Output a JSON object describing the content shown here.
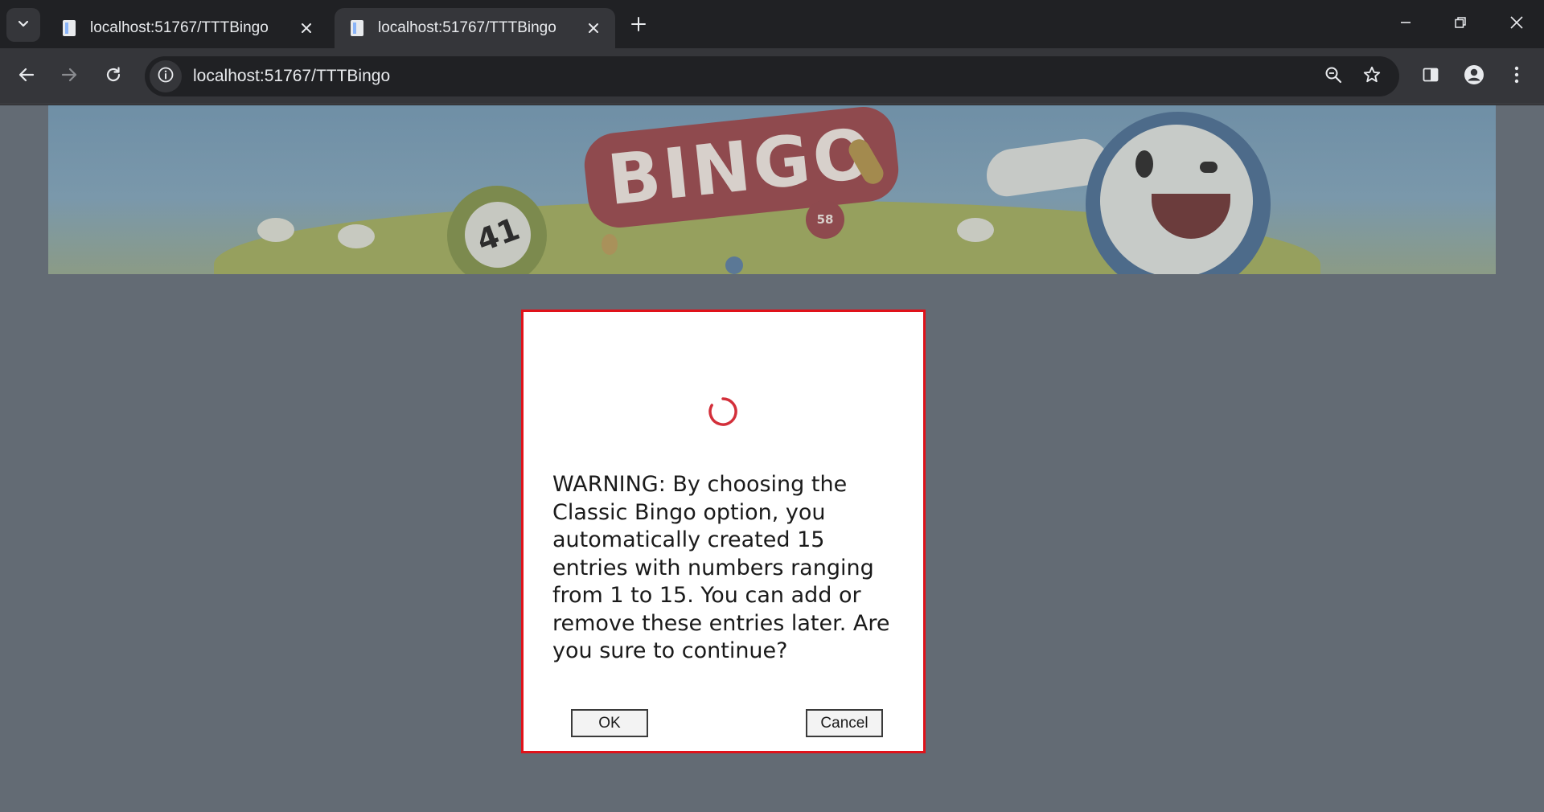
{
  "browser": {
    "tabs": [
      {
        "title": "localhost:51767/TTTBingo",
        "active": false
      },
      {
        "title": "localhost:51767/TTTBingo",
        "active": true
      }
    ],
    "url": "localhost:51767/TTTBingo",
    "icons": {
      "tab_search": "chevron-down-icon",
      "favicon": "page-icon",
      "close": "close-icon",
      "new_tab": "plus-icon",
      "minimize": "minimize-icon",
      "restore": "restore-icon",
      "window_close": "close-icon",
      "back": "back-arrow-icon",
      "forward": "forward-arrow-icon",
      "reload": "reload-icon",
      "site_info": "info-icon",
      "zoom": "zoom-icon",
      "bookmark": "star-icon",
      "side_panel": "side-panel-icon",
      "profile": "profile-icon",
      "menu": "kebab-menu-icon"
    }
  },
  "banner": {
    "word": "BINGO",
    "ball_left": "41",
    "ball_middle": "58"
  },
  "dialog": {
    "message": "WARNING: By choosing the Classic Bingo option, you automatically created 15 entries with numbers ranging from 1 to 15. You can add or remove these entries later. Are you sure to continue?",
    "ok_label": "OK",
    "cancel_label": "Cancel",
    "border_color": "#e0121a",
    "spinner_color": "#d32f3a"
  }
}
